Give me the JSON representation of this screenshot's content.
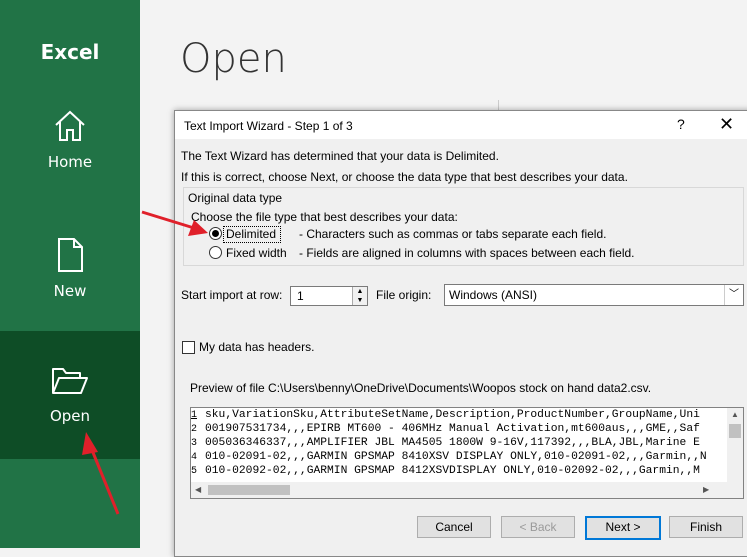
{
  "sidebar": {
    "app_title": "Excel",
    "items": [
      {
        "label": "Home",
        "icon": "home-icon"
      },
      {
        "label": "New",
        "icon": "new-file-icon"
      },
      {
        "label": "Open",
        "icon": "open-folder-icon"
      }
    ]
  },
  "main": {
    "title": "Open"
  },
  "dialog": {
    "title": "Text Import Wizard - Step 1 of 3",
    "help": "?",
    "close": "✕",
    "intro1": "The Text Wizard has determined that your data is Delimited.",
    "intro2": "If this is correct, choose Next, or choose the data type that best describes your data.",
    "group_label": "Original data type",
    "choose_label": "Choose the file type that best describes your data:",
    "options": [
      {
        "label": "Delimited",
        "desc": "- Characters such as commas or tabs separate each field.",
        "selected": true
      },
      {
        "label": "Fixed width",
        "desc": "- Fields are aligned in columns with spaces between each field.",
        "selected": false
      }
    ],
    "start_row_label": "Start import at row:",
    "start_row_value": "1",
    "file_origin_label": "File origin:",
    "file_origin_value": "Windows (ANSI)",
    "headers_label": "My data has headers.",
    "preview_label": "Preview of file C:\\Users\\benny\\OneDrive\\Documents\\Woopos stock on hand data2.csv.",
    "preview_rows": [
      {
        "n": "1",
        "text": "sku,VariationSku,AttributeSetName,Description,ProductNumber,GroupName,Uni"
      },
      {
        "n": "2",
        "text": "001907531734,,,EPIRB MT600 - 406MHz Manual Activation,mt600aus,,,GME,,Saf"
      },
      {
        "n": "3",
        "text": "005036346337,,,AMPLIFIER JBL MA4505 1800W 9-16V,117392,,,BLA,JBL,Marine E"
      },
      {
        "n": "4",
        "text": "010-02091-02,,,GARMIN GPSMAP 8410XSV DISPLAY ONLY,010-02091-02,,,Garmin,,N"
      },
      {
        "n": "5",
        "text": "010-02092-02,,,GARMIN GPSMAP 8412XSVDISPLAY ONLY,010-02092-02,,,Garmin,,M"
      }
    ],
    "buttons": {
      "cancel": "Cancel",
      "back": "< Back",
      "next": "Next >",
      "finish": "Finish"
    }
  },
  "annotation_color": "#e0202a"
}
